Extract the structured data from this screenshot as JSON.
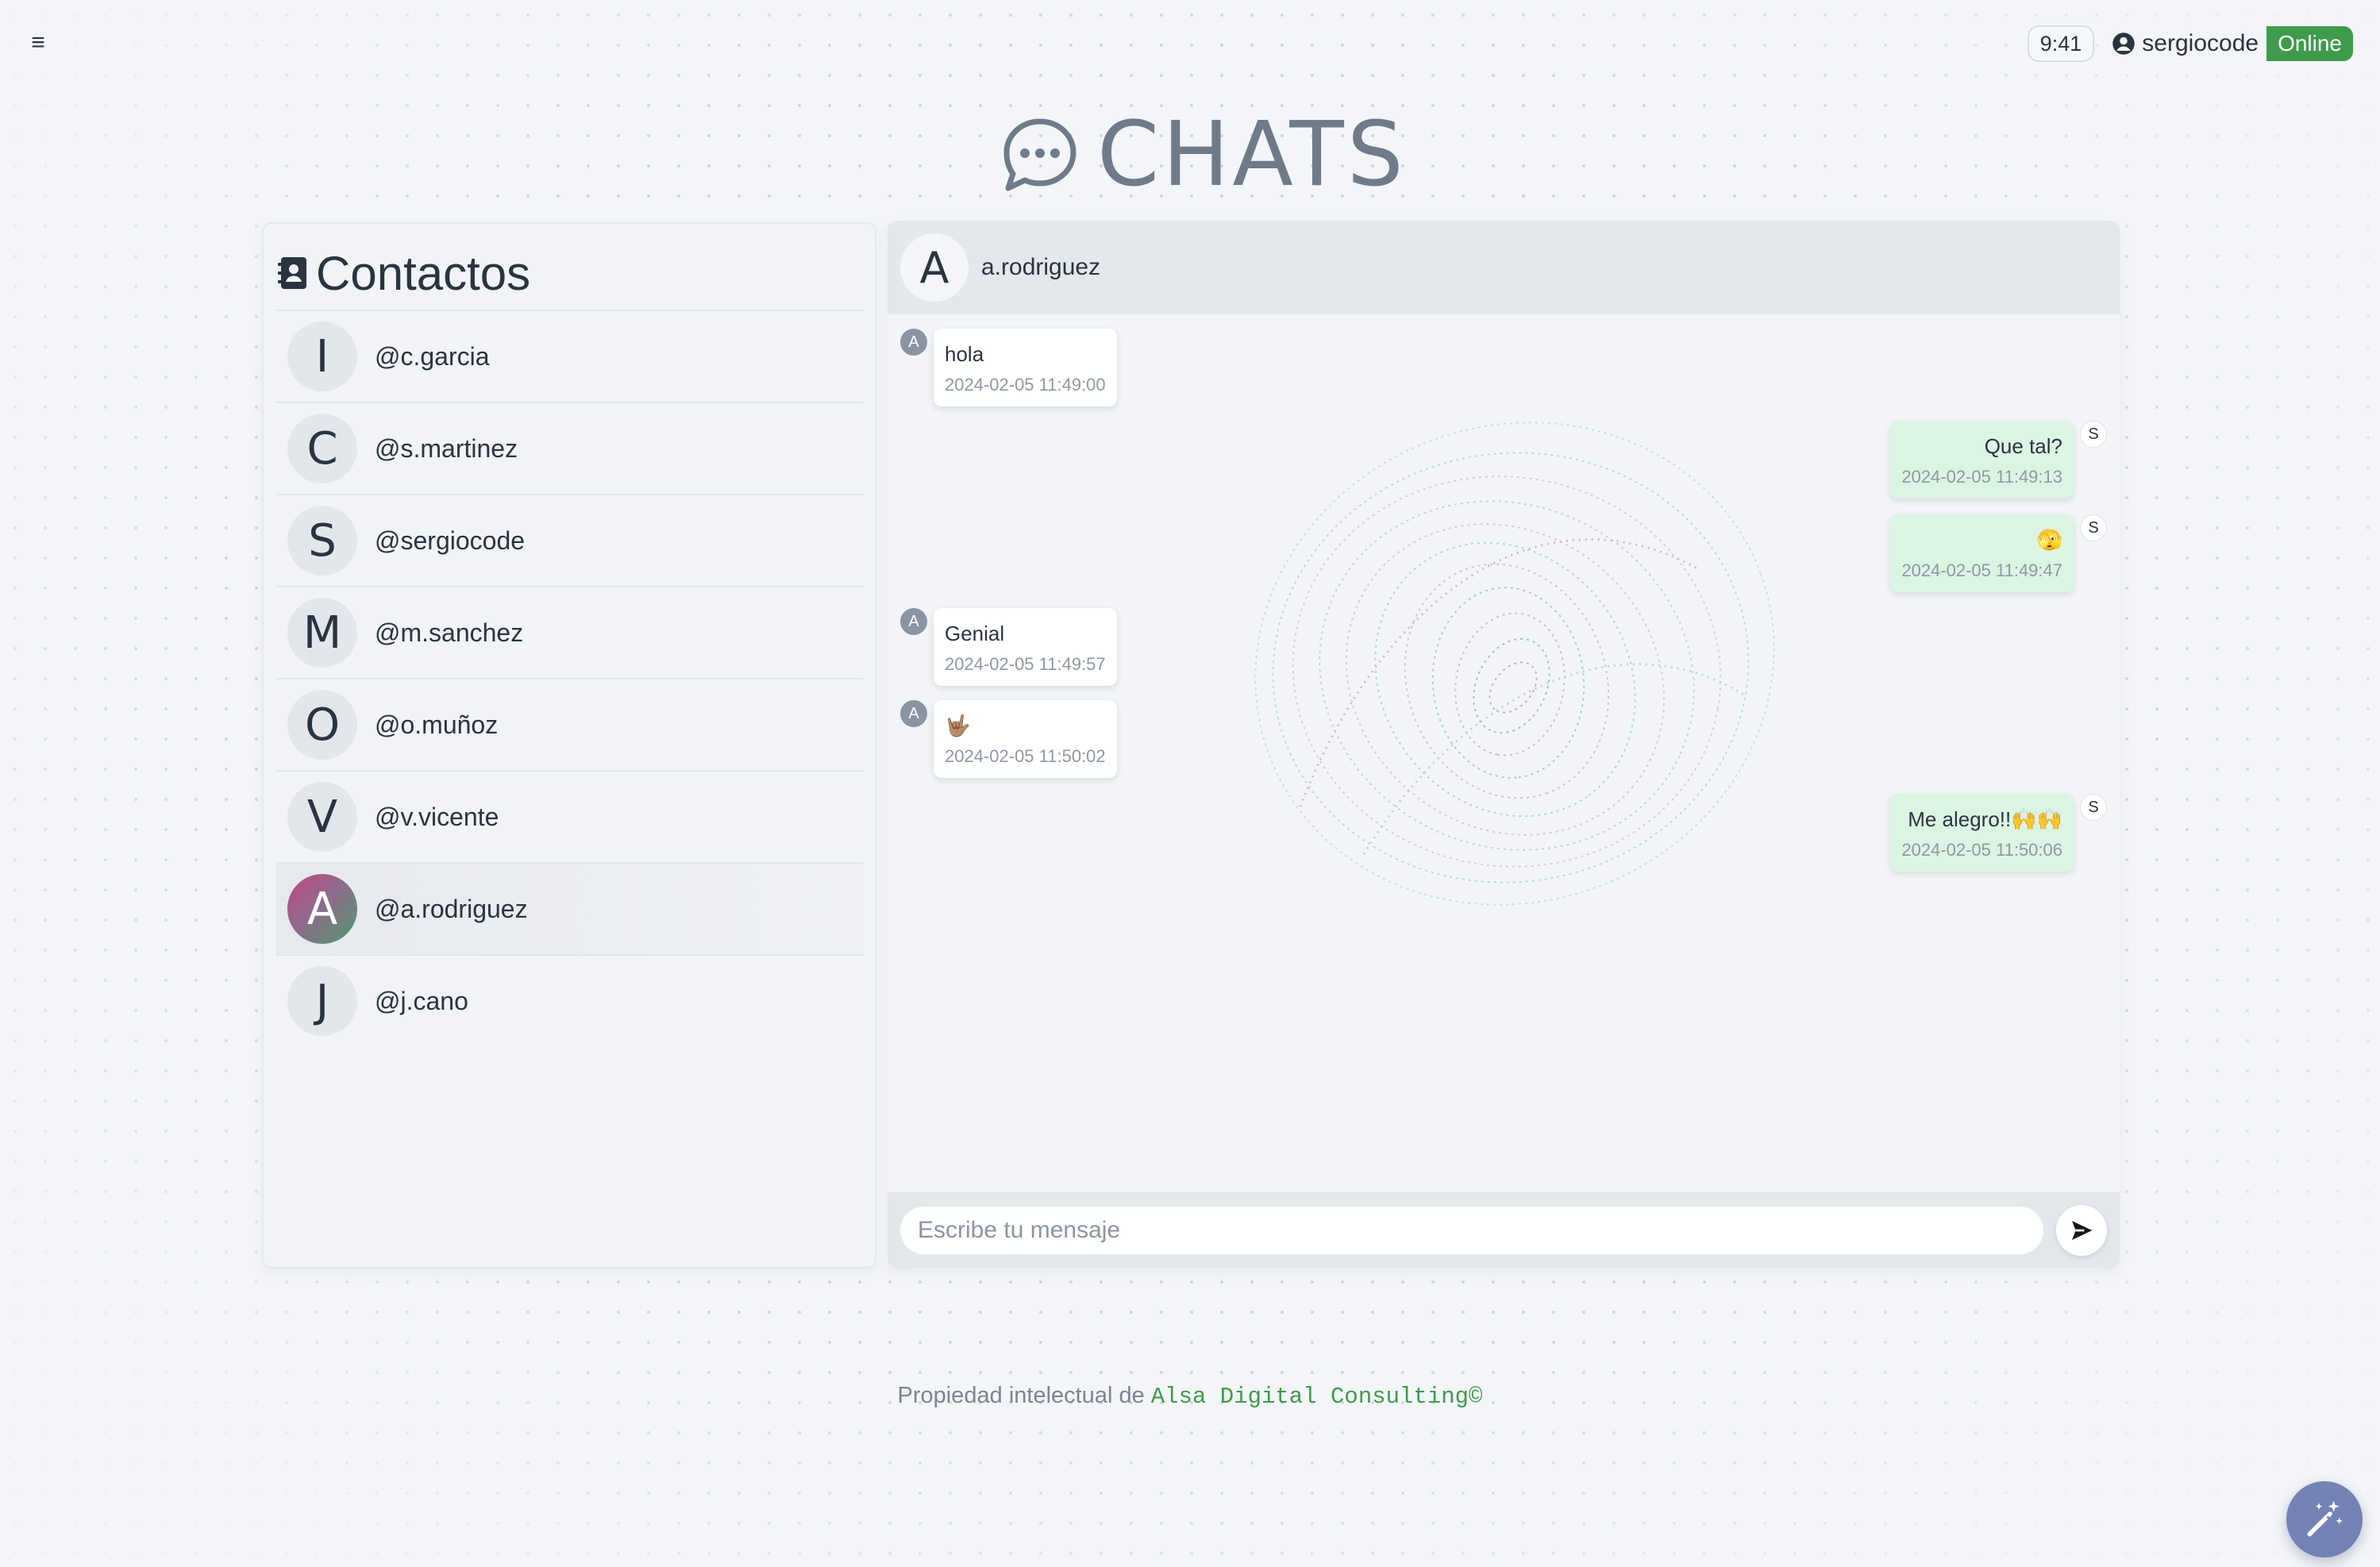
{
  "topbar": {
    "menu_icon": "hamburger-icon",
    "time": "9:41",
    "username": "sergiocode",
    "status": "Online",
    "status_color": "#3f9b4c"
  },
  "page_title": "CHATS",
  "contacts": {
    "title": "Contactos",
    "items": [
      {
        "initial": "I",
        "handle": "@c.garcia",
        "active": false
      },
      {
        "initial": "C",
        "handle": "@s.martinez",
        "active": false
      },
      {
        "initial": "S",
        "handle": "@sergiocode",
        "active": false
      },
      {
        "initial": "M",
        "handle": "@m.sanchez",
        "active": false
      },
      {
        "initial": "O",
        "handle": "@o.muñoz",
        "active": false
      },
      {
        "initial": "V",
        "handle": "@v.vicente",
        "active": false
      },
      {
        "initial": "A",
        "handle": "@a.rodriguez",
        "active": true
      },
      {
        "initial": "J",
        "handle": "@j.cano",
        "active": false
      }
    ]
  },
  "chat": {
    "header": {
      "initial": "A",
      "name": "a.rodriguez"
    },
    "messages": [
      {
        "direction": "in",
        "sender_initial": "A",
        "text": "hola",
        "time": "2024-02-05 11:49:00"
      },
      {
        "direction": "out",
        "sender_initial": "S",
        "text": "Que tal?",
        "time": "2024-02-05 11:49:13"
      },
      {
        "direction": "out",
        "sender_initial": "S",
        "text": "🫣",
        "time": "2024-02-05 11:49:47"
      },
      {
        "direction": "in",
        "sender_initial": "A",
        "text": "Genial",
        "time": "2024-02-05 11:49:57"
      },
      {
        "direction": "in",
        "sender_initial": "A",
        "text": "🤟🏽",
        "time": "2024-02-05 11:50:02"
      },
      {
        "direction": "out",
        "sender_initial": "S",
        "text": "Me alegro!!🙌🙌",
        "time": "2024-02-05 11:50:06"
      }
    ],
    "composer": {
      "placeholder": "Escribe tu mensaje",
      "value": ""
    }
  },
  "footer": {
    "prefix": "Propiedad intelectual de ",
    "brand": "Alsa Digital Consulting©"
  },
  "colors": {
    "accent": "#3f9b4c",
    "out_bubble": "#dcf4e2",
    "magic_button": "#7482b6"
  }
}
